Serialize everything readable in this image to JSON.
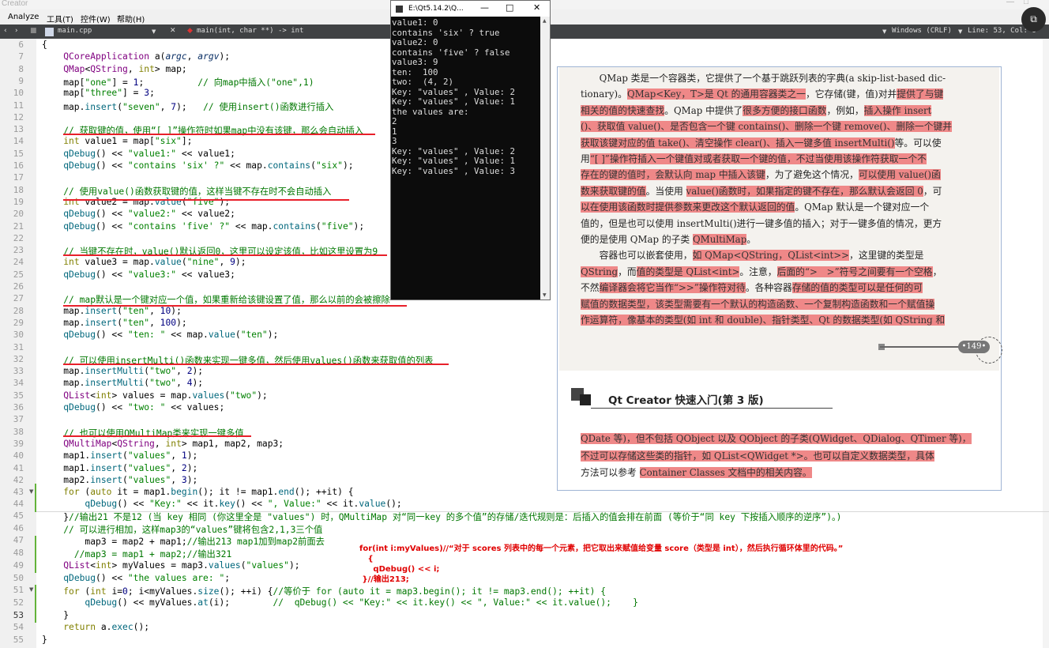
{
  "app": {
    "title_fragment": "Creator",
    "menus": [
      "Analyze",
      "工具(T)",
      "控件(W)",
      "帮助(H)"
    ]
  },
  "toolbar": {
    "file_tab": "main.cpp",
    "function_crumb": "main(int, char **) -> int",
    "encoding": "Windows (CRLF)",
    "position": "Line: 53, Col: 6"
  },
  "editor": {
    "lines_top": [
      {
        "no": "6",
        "code": "{"
      },
      {
        "no": "7",
        "code": "    QCoreApplication a(argc, argv);"
      },
      {
        "no": "8",
        "code": "    QMap<QString, int> map;"
      },
      {
        "no": "9",
        "code": "    map[\"one\"] = 1;          // 向map中插入(\"one\",1)"
      },
      {
        "no": "10",
        "code": "    map[\"three\"] = 3;"
      },
      {
        "no": "11",
        "code": "    map.insert(\"seven\", 7);   // 使用insert()函数进行插入"
      },
      {
        "no": "12",
        "code": ""
      },
      {
        "no": "13",
        "code": "    // 获取键的值，使用“[ ]”操作符时如果map中没有该键，那么会自动插入"
      },
      {
        "no": "14",
        "code": "    int value1 = map[\"six\"];"
      },
      {
        "no": "15",
        "code": "    qDebug() << \"value1:\" << value1;"
      },
      {
        "no": "16",
        "code": "    qDebug() << \"contains 'six' ?\" << map.contains(\"six\");"
      },
      {
        "no": "17",
        "code": ""
      },
      {
        "no": "18",
        "code": "    // 使用value()函数获取键的值，这样当键不存在时不会自动插入"
      },
      {
        "no": "19",
        "code": "    int value2 = map.value(\"five\");"
      },
      {
        "no": "20",
        "code": "    qDebug() << \"value2:\" << value2;"
      },
      {
        "no": "21",
        "code": "    qDebug() << \"contains 'five' ?\" << map.contains(\"five\");"
      },
      {
        "no": "22",
        "code": ""
      },
      {
        "no": "23",
        "code": "    // 当键不存在时，value()默认返回0，这里可以设定该值，比如这里设置为9"
      },
      {
        "no": "24",
        "code": "    int value3 = map.value(\"nine\", 9);"
      },
      {
        "no": "25",
        "code": "    qDebug() << \"value3:\" << value3;"
      },
      {
        "no": "26",
        "code": ""
      },
      {
        "no": "27",
        "code": "    // map默认是一个键对应一个值，如果重新给该键设置了值，那么以前的会被擦除"
      },
      {
        "no": "28",
        "code": "    map.insert(\"ten\", 10);"
      },
      {
        "no": "29",
        "code": "    map.insert(\"ten\", 100);"
      },
      {
        "no": "30",
        "code": "    qDebug() << \"ten: \" << map.value(\"ten\");"
      },
      {
        "no": "31",
        "code": ""
      },
      {
        "no": "32",
        "code": "    // 可以使用insertMulti()函数来实现一键多值，然后使用values()函数来获取值的列表"
      },
      {
        "no": "33",
        "code": "    map.insertMulti(\"two\", 2);"
      },
      {
        "no": "34",
        "code": "    map.insertMulti(\"two\", 4);"
      },
      {
        "no": "35",
        "code": "    QList<int> values = map.values(\"two\");"
      },
      {
        "no": "36",
        "code": "    qDebug() << \"two: \" << values;"
      },
      {
        "no": "37",
        "code": ""
      },
      {
        "no": "38",
        "code": "    // 也可以使用QMultiMap类来实现一键多值"
      },
      {
        "no": "39",
        "code": "    QMultiMap<QString, int> map1, map2, map3;"
      },
      {
        "no": "40",
        "code": "    map1.insert(\"values\", 1);"
      },
      {
        "no": "41",
        "code": "    map1.insert(\"values\", 2);"
      },
      {
        "no": "42",
        "code": "    map2.insert(\"values\", 3);"
      },
      {
        "no": "43",
        "code": "    for (auto it = map1.begin(); it != map1.end(); ++it) {"
      },
      {
        "no": "44",
        "code": "        qDebug() << \"Key:\" << it.key() << \", Value:\" << it.value();"
      }
    ],
    "lines_bottom": [
      {
        "no": "45",
        "code": "    }//输出21 不是12 (当 key 相同 (你这里全是 \"values\") 时，QMultiMap 对“同一key 的多个值”的存储/迭代规则是：后插入的值会排在前面 (等价于“同 key 下按插入顺序的逆序”)。)"
      },
      {
        "no": "46",
        "code": "    // 可以进行相加，这样map3的“values”键将包含2,1,3三个值"
      },
      {
        "no": "47",
        "code": "        map3 = map2 + map1;//输出213 map1加到map2前面去"
      },
      {
        "no": "48",
        "code": "      //map3 = map1 + map2;//输出321"
      },
      {
        "no": "49",
        "code": "    QList<int> myValues = map3.values(\"values\");"
      },
      {
        "no": "50",
        "code": "    qDebug() << \"the values are: \";"
      },
      {
        "no": "51",
        "code": "    for (int i=0; i<myValues.size(); ++i) {//等价于 for (auto it = map3.begin(); it != map3.end(); ++it) {"
      },
      {
        "no": "52",
        "code": "        qDebug() << myValues.at(i);        //  qDebug() << \"Key:\" << it.key() << \", Value:\" << it.value();    }"
      },
      {
        "no": "53",
        "code": "    }"
      },
      {
        "no": "54",
        "code": "    return a.exec();"
      },
      {
        "no": "55",
        "code": "}"
      }
    ]
  },
  "annotation": {
    "line1": "for(int i:myValues)//“对于 scores 列表中的每一个元素，把它取出来赋值给变量 score（类型是 int），然后执行循环体里的代码。”",
    "line2": "{",
    "line3": "qDebug() << i;",
    "line4": "}//输出213;"
  },
  "console": {
    "title": "E:\\Qt5.14.2\\Q...",
    "output": "value1: 0\ncontains 'six' ? true\nvalue2: 0\ncontains 'five' ? false\nvalue3: 9\nten:  100\ntwo:  (4, 2)\nKey: \"values\" , Value: 2\nKey: \"values\" , Value: 1\nthe values are:\n2\n1\n3\nKey: \"values\" , Value: 2\nKey: \"values\" , Value: 1\nKey: \"values\" , Value: 3"
  },
  "book": {
    "lines": [
      "　　QMap 类是一个容器类，它提供了一个基于跳跃列表的字典(a skip-list-based dic-",
      "tionary)。QMap<Key，T>是 Qt 的通用容器类之一，它存储(键，值)对并提供了与键",
      "相关的值的快速查找。QMap 中提供了很多方便的接口函数，例如，插入操作 insert",
      "()、获取值 value()、是否包含一个键 contains()、删除一个键 remove()、删除一个键并",
      "获取该键对应的值 take()、清空操作 clear()、插入一键多值 insertMulti()等。可以使",
      "用“[ ]”操作符插入一个键值对或者获取一个键的值，不过当使用该操作符获取一个不",
      "存在的键的值时，会默认向 map 中插入该键，为了避免这个情况，可以使用 value()函",
      "数来获取键的值。当使用 value()函数时，如果指定的键不存在，那么默认会返回 0，可",
      "以在使用该函数时提供参数来更改这个默认返回的值。QMap 默认是一个键对应一个",
      "值的，但是也可以使用 insertMulti()进行一键多值的插入；对于一键多值的情况，更方",
      "便的是使用 QMap 的子类 QMultiMap。",
      "　　容器也可以嵌套使用，如 QMap<QString，QList<int>>，这里键的类型是",
      "QString，而值的类型是 QList<int>。注意，后面的“>　>”符号之间要有一个空格，",
      "不然编译器会将它当作“>>”操作符对待。各种容器存储的值的类型可以是任何的可",
      "赋值的数据类型，该类型需要有一个默认的构造函数、一个复制构造函数和一个赋值操",
      "作运算符，像基本的类型(如 int 和 double)、指针类型、Qt 的数据类型(如 QString 和"
    ],
    "page_number": "•149•",
    "chapter_title": "Qt Creator 快速入门(第 3 版)",
    "bottom_lines": [
      "QDate 等)，但不包括 QObject 以及 QObject 的子类(QWidget、QDialog、QTimer 等)，",
      "不过可以存储这些类的指针，如 QList<QWidget *>。也可以自定义数据类型，具体",
      "方法可以参考 Container Classes 文档中的相关内容。"
    ]
  },
  "colors": {
    "highlight": "#ef8888",
    "underline": "#e8202a",
    "comment": "#007700",
    "toolbar": "#404244"
  }
}
